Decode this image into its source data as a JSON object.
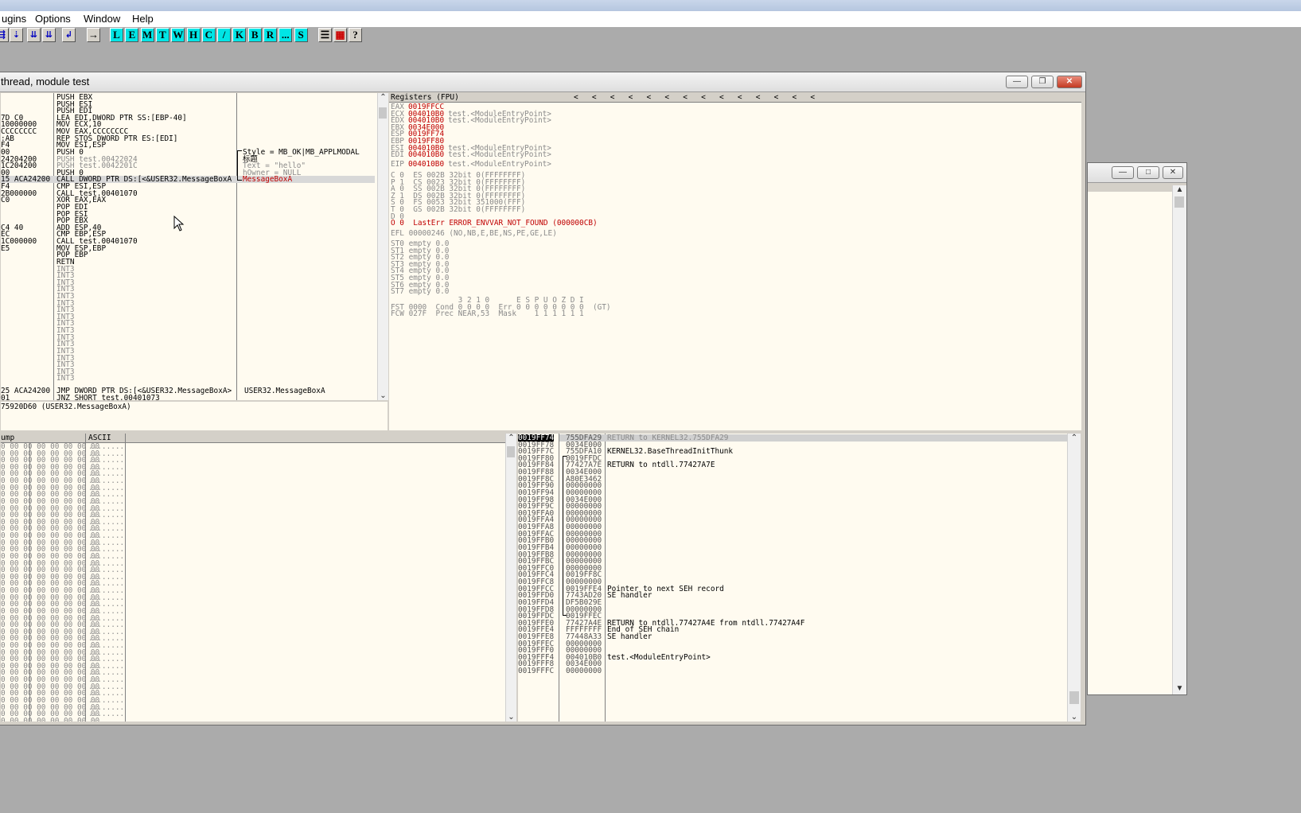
{
  "menu": [
    "ugins",
    "Options",
    "Window",
    "Help"
  ],
  "toolbar_letters": [
    "L",
    "E",
    "M",
    "T",
    "W",
    "H",
    "C",
    "/",
    "K",
    "B",
    "R",
    "...",
    "S"
  ],
  "cpu_title": "thread, module test",
  "disasm": {
    "addr_col": [
      "",
      "",
      "",
      "7D C0",
      "10000000",
      "CCCCCCCC",
      ":AB",
      "F4",
      "00",
      "24204200",
      "1C204200",
      "00",
      "15 ACA24200",
      "F4",
      "2B000000",
      "C0",
      "",
      "",
      "",
      "C4 40",
      "EC",
      "1C000000",
      "E5",
      "",
      "",
      "",
      "",
      "",
      "",
      "",
      "",
      "",
      "",
      "",
      "",
      "",
      "",
      "",
      "",
      "",
      "",
      "",
      ""
    ],
    "code": [
      "PUSH EBX",
      "PUSH ESI",
      "PUSH EDI",
      "LEA EDI,DWORD PTR SS:[EBP-40]",
      "MOV ECX,10",
      "MOV EAX,CCCCCCCC",
      "REP STOS DWORD PTR ES:[EDI]",
      "MOV ESI,ESP",
      "PUSH 0",
      "PUSH test.00422024",
      "PUSH test.0042201C",
      "PUSH 0",
      "CALL DWORD PTR DS:[<&USER32.MessageBoxA",
      "CMP ESI,ESP",
      "CALL test.00401070",
      "XOR EAX,EAX",
      "POP EDI",
      "POP ESI",
      "POP EBX",
      "ADD ESP,40",
      "CMP EBP,ESP",
      "CALL test.00401070",
      "MOV ESP,EBP",
      "POP EBP",
      "RETN",
      "INT3",
      "INT3",
      "INT3",
      "INT3",
      "INT3",
      "INT3",
      "INT3",
      "INT3",
      "INT3",
      "INT3",
      "INT3",
      "INT3",
      "INT3",
      "INT3",
      "INT3",
      "INT3",
      "INT3"
    ],
    "comments": [
      {
        "row": 8,
        "text": "Style = MB_OK|MB_APPLMODAL",
        "cls": ""
      },
      {
        "row": 9,
        "text": "标题",
        "cls": ""
      },
      {
        "row": 10,
        "text": "Text = \"hello\"",
        "cls": ""
      },
      {
        "row": 11,
        "text": "hOwner = NULL",
        "cls": ""
      },
      {
        "row": 12,
        "text": "MessageBoxA",
        "cls": "red"
      }
    ],
    "bottom_addr": [
      "25 ACA24200",
      "01"
    ],
    "bottom_code": [
      "JMP DWORD PTR DS:[<&USER32.MessageBoxA>",
      "JNZ SHORT test.00401073"
    ],
    "bottom_comment": "USER32.MessageBoxA",
    "info_line": "75920D60 (USER32.MessageBoxA)"
  },
  "registers": {
    "header": "Registers (FPU)",
    "arrows": "<   <   <   <   <   <   <   <   <   <   <   <   <   <",
    "gpr": [
      {
        "name": "EAX",
        "val": "0019FFCC",
        "info": ""
      },
      {
        "name": "ECX",
        "val": "004010B0",
        "info": "test.<ModuleEntryPoint>"
      },
      {
        "name": "EDX",
        "val": "004010B0",
        "info": "test.<ModuleEntryPoint>"
      },
      {
        "name": "EBX",
        "val": "0034E000",
        "info": ""
      },
      {
        "name": "ESP",
        "val": "0019FF74",
        "info": ""
      },
      {
        "name": "EBP",
        "val": "0019FF80",
        "info": ""
      },
      {
        "name": "ESI",
        "val": "004010B0",
        "info": "test.<ModuleEntryPoint>"
      },
      {
        "name": "EDI",
        "val": "004010B0",
        "info": "test.<ModuleEntryPoint>"
      }
    ],
    "eip": {
      "name": "EIP",
      "val": "004010B0",
      "info": "test.<ModuleEntryPoint>"
    },
    "flags": [
      "C 0  ES 002B 32bit 0(FFFFFFFF)",
      "P 1  CS 0023 32bit 0(FFFFFFFF)",
      "A 0  SS 002B 32bit 0(FFFFFFFF)",
      "Z 1  DS 002B 32bit 0(FFFFFFFF)",
      "S 0  FS 0053 32bit 351000(FFF)",
      "T 0  GS 002B 32bit 0(FFFFFFFF)",
      "D 0",
      "O 0  LastErr ERROR_ENVVAR_NOT_FOUND (000000CB)"
    ],
    "efl": "EFL 00000246 (NO,NB,E,BE,NS,PE,GE,LE)",
    "st": [
      "ST0 empty 0.0",
      "ST1 empty 0.0",
      "ST2 empty 0.0",
      "ST3 empty 0.0",
      "ST4 empty 0.0",
      "ST5 empty 0.0",
      "ST6 empty 0.0",
      "ST7 empty 0.0"
    ],
    "fpu": [
      "               3 2 1 0      E S P U O Z D I",
      "FST 0000  Cond 0 0 0 0  Err 0 0 0 0 0 0 0 0  (GT)",
      "FCW 027F  Prec NEAR,53  Mask    1 1 1 1 1 1"
    ]
  },
  "dump": {
    "col_hex": "ump",
    "col_ascii": "ASCII",
    "hex_row": "0 00 00 00 00 00 00 00",
    "ascii_row": "........",
    "rows": 41
  },
  "stack": {
    "rows": [
      {
        "addr": "0019FF74",
        "val": "755DFA29",
        "cmt": "RETURN to KERNEL32.755DFA29",
        "sel": true
      },
      {
        "addr": "0019FF78",
        "val": "0034E000",
        "cmt": ""
      },
      {
        "addr": "0019FF7C",
        "val": "755DFA10",
        "cmt": "KERNEL32.BaseThreadInitThunk"
      },
      {
        "addr": "0019FF80",
        "val": "0019FFDC",
        "cmt": ""
      },
      {
        "addr": "0019FF84",
        "val": "77427A7E",
        "cmt": "RETURN to ntdll.77427A7E"
      },
      {
        "addr": "0019FF88",
        "val": "0034E000",
        "cmt": ""
      },
      {
        "addr": "0019FF8C",
        "val": "A80E3462",
        "cmt": ""
      },
      {
        "addr": "0019FF90",
        "val": "00000000",
        "cmt": ""
      },
      {
        "addr": "0019FF94",
        "val": "00000000",
        "cmt": ""
      },
      {
        "addr": "0019FF98",
        "val": "0034E000",
        "cmt": ""
      },
      {
        "addr": "0019FF9C",
        "val": "00000000",
        "cmt": ""
      },
      {
        "addr": "0019FFA0",
        "val": "00000000",
        "cmt": ""
      },
      {
        "addr": "0019FFA4",
        "val": "00000000",
        "cmt": ""
      },
      {
        "addr": "0019FFA8",
        "val": "00000000",
        "cmt": ""
      },
      {
        "addr": "0019FFAC",
        "val": "00000000",
        "cmt": ""
      },
      {
        "addr": "0019FFB0",
        "val": "00000000",
        "cmt": ""
      },
      {
        "addr": "0019FFB4",
        "val": "00000000",
        "cmt": ""
      },
      {
        "addr": "0019FFB8",
        "val": "00000000",
        "cmt": ""
      },
      {
        "addr": "0019FFBC",
        "val": "00000000",
        "cmt": ""
      },
      {
        "addr": "0019FFC0",
        "val": "00000000",
        "cmt": ""
      },
      {
        "addr": "0019FFC4",
        "val": "0019FF8C",
        "cmt": ""
      },
      {
        "addr": "0019FFC8",
        "val": "00000000",
        "cmt": ""
      },
      {
        "addr": "0019FFCC",
        "val": "0019FFE4",
        "cmt": "Pointer to next SEH record"
      },
      {
        "addr": "0019FFD0",
        "val": "7743AD20",
        "cmt": "SE handler"
      },
      {
        "addr": "0019FFD4",
        "val": "DF5B029E",
        "cmt": ""
      },
      {
        "addr": "0019FFD8",
        "val": "00000000",
        "cmt": ""
      },
      {
        "addr": "0019FFDC",
        "val": "0019FFEC",
        "cmt": ""
      },
      {
        "addr": "0019FFE0",
        "val": "77427A4E",
        "cmt": "RETURN to ntdll.77427A4E from ntdll.77427A4F"
      },
      {
        "addr": "0019FFE4",
        "val": "FFFFFFFF",
        "cmt": "End of SEH chain"
      },
      {
        "addr": "0019FFE8",
        "val": "77448A33",
        "cmt": "SE handler"
      },
      {
        "addr": "0019FFEC",
        "val": "00000000",
        "cmt": ""
      },
      {
        "addr": "0019FFF0",
        "val": "00000000",
        "cmt": ""
      },
      {
        "addr": "0019FFF4",
        "val": "004010B0",
        "cmt": "test.<ModuleEntryPoint>"
      },
      {
        "addr": "0019FFF8",
        "val": "0034E000",
        "cmt": ""
      },
      {
        "addr": "0019FFFC",
        "val": "00000000",
        "cmt": ""
      }
    ]
  },
  "colors": {
    "pane_bg": "#fffbf0",
    "red": "#c00000",
    "workspace": "#ababab"
  }
}
